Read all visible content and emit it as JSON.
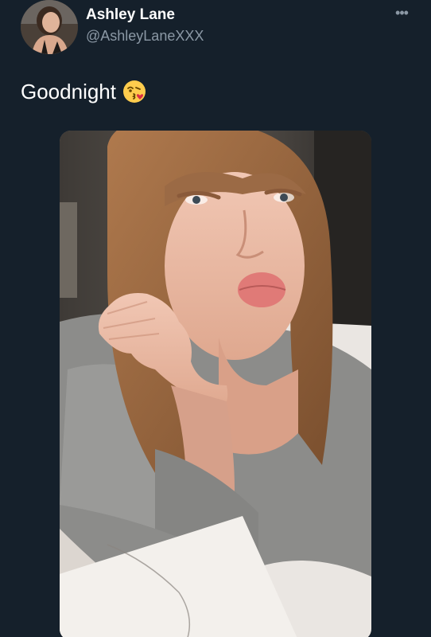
{
  "author": {
    "display_name": "Ashley Lane",
    "handle": "@AshleyLaneXXX"
  },
  "tweet": {
    "text": "Goodnight"
  },
  "icons": {
    "more": "more-options-icon",
    "emoji": "face-blowing-a-kiss-emoji"
  },
  "colors": {
    "background": "#15202b",
    "primary_text": "#ffffff",
    "secondary_text": "#8b98a5"
  }
}
